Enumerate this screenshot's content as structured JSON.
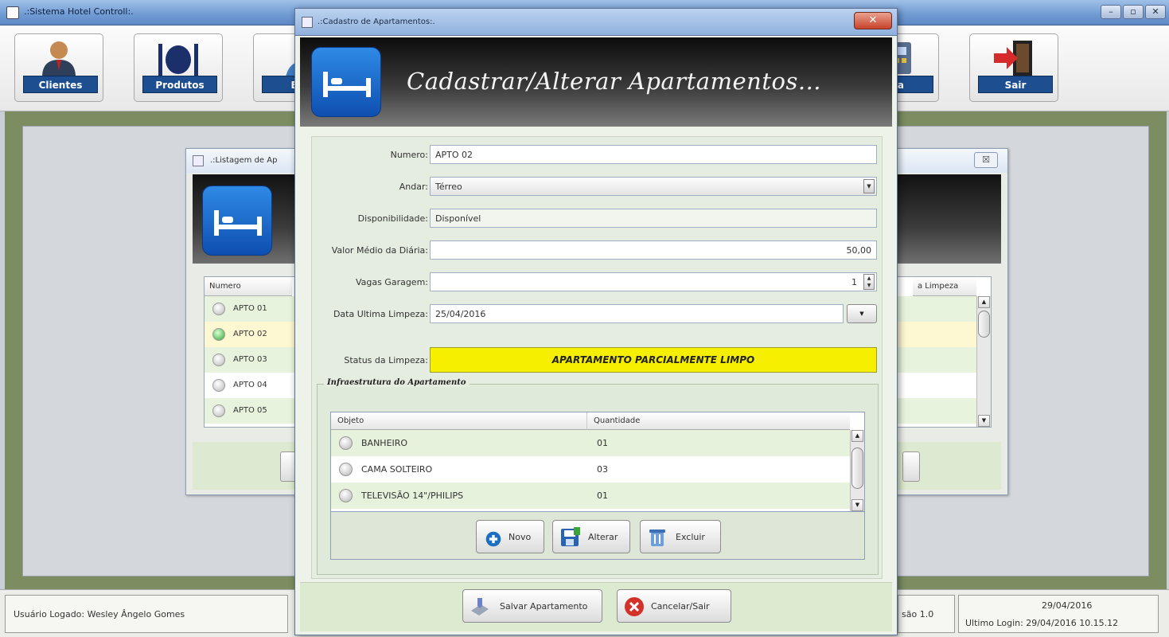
{
  "main_window": {
    "title": ".:Sistema Hotel Controll:."
  },
  "toolbar": {
    "buttons": [
      {
        "label": "Clientes",
        "icon": "client-person-icon"
      },
      {
        "label": "Produtos",
        "icon": "food-plate-icon"
      },
      {
        "label": "Est",
        "icon": "stock-person-icon"
      },
      {
        "label": "ixa",
        "icon": "cash-register-icon"
      },
      {
        "label": "Sair",
        "icon": "exit-door-icon"
      }
    ]
  },
  "listing_window": {
    "title": ".:Listagem de Ap",
    "close_label": "☒",
    "columns": [
      "Numero",
      "a Limpeza"
    ],
    "rows": [
      {
        "numero": "APTO 01",
        "status": "inactive"
      },
      {
        "numero": "APTO 02",
        "status": "active"
      },
      {
        "numero": "APTO 03",
        "status": "inactive"
      },
      {
        "numero": "APTO 04",
        "status": "inactive"
      },
      {
        "numero": "APTO 05",
        "status": "inactive"
      }
    ],
    "row_colors": [
      "#e8f3de",
      "#fdf7d2",
      "#e8f3de",
      "#ffffff",
      "#e8f3de"
    ]
  },
  "statusbar": {
    "user": "Usuário Logado: Wesley Ângelo Gomes",
    "version": "são 1.0",
    "date": "29/04/2016",
    "last_login": "Ultimo Login: 29/04/2016 10.15.12"
  },
  "dialog": {
    "title": ".:Cadastro de Apartamentos:.",
    "close_label": "✕",
    "heading": "Cadastrar/Alterar Apartamentos...",
    "form": {
      "numero": {
        "label": "Numero:",
        "value": "APTO 02"
      },
      "andar": {
        "label": "Andar:",
        "value": "Térreo"
      },
      "disponibilidade": {
        "label": "Disponibilidade:",
        "value": "Disponível"
      },
      "valor_medio": {
        "label": "Valor Médio da Diária:",
        "value": "50,00"
      },
      "vagas_garagem": {
        "label": "Vagas Garagem:",
        "value": "1"
      },
      "data_limpeza": {
        "label": "Data Ultima Limpeza:",
        "value": "25/04/2016"
      },
      "status_limpeza": {
        "label": "Status da Limpeza:",
        "value": "APARTAMENTO PARCIALMENTE LIMPO"
      }
    },
    "status_color": "#f6ef00",
    "infra": {
      "legend": "Infraestrutura do Apartamento",
      "columns": [
        "Objeto",
        "Quantidade"
      ],
      "rows": [
        {
          "objeto": "BANHEIRO",
          "quantidade": "01"
        },
        {
          "objeto": "CAMA SOLTEIRO",
          "quantidade": "03"
        },
        {
          "objeto": "TELEVISÃO 14\"/PHILIPS",
          "quantidade": "01"
        }
      ],
      "buttons": {
        "novo": "Novo",
        "alterar": "Alterar",
        "excluir": "Excluir"
      }
    },
    "footer": {
      "save": "Salvar Apartamento",
      "cancel": "Cancelar/Sair"
    }
  }
}
